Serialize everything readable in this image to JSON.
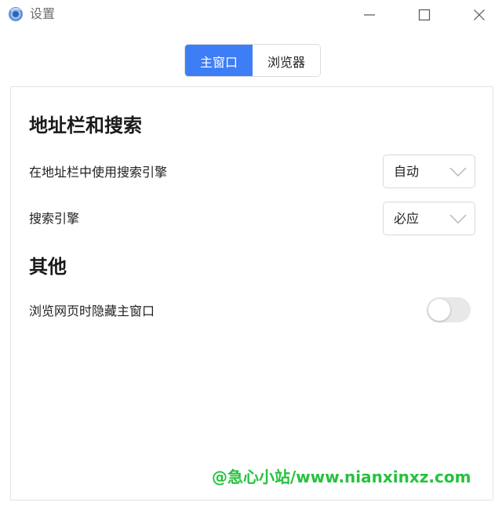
{
  "window": {
    "title": "设置"
  },
  "tabs": [
    {
      "label": "主窗口",
      "active": true
    },
    {
      "label": "浏览器",
      "active": false
    }
  ],
  "sections": {
    "address_bar": {
      "heading": "地址栏和搜索",
      "use_search_engine": {
        "label": "在地址栏中使用搜索引擎",
        "value": "自动"
      },
      "search_engine": {
        "label": "搜索引擎",
        "value": "必应"
      }
    },
    "other": {
      "heading": "其他",
      "hide_main_window": {
        "label": "浏览网页时隐藏主窗口",
        "enabled": false
      }
    }
  },
  "watermark": "@急心小站/www.nianxinxz.com",
  "colors": {
    "accent": "#3d7ef7",
    "toggle_off": "#e8e8e8",
    "watermark": "#25c23c"
  }
}
